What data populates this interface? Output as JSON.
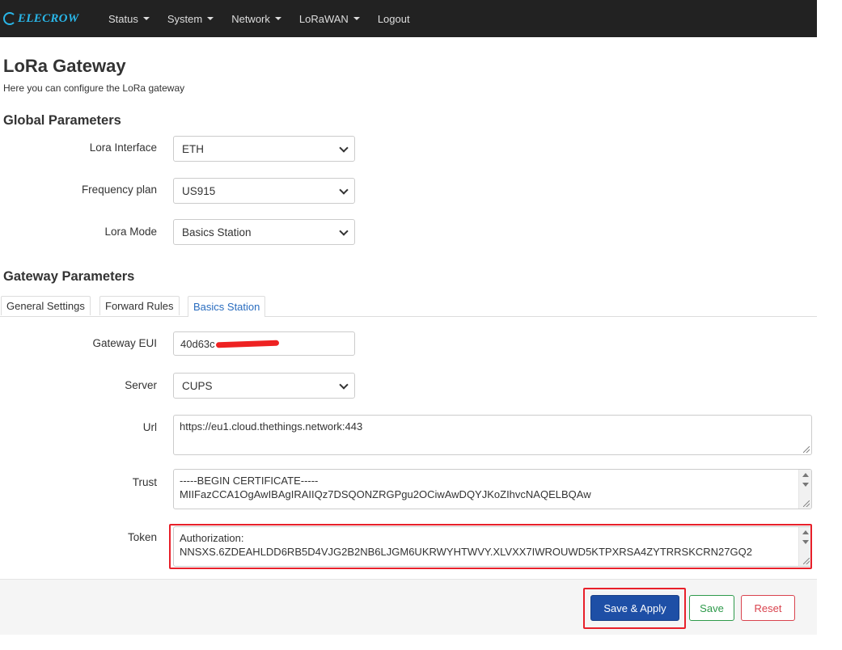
{
  "brand": {
    "name": "ELECROW",
    "color": "#29b6e8"
  },
  "nav": [
    {
      "label": "Status",
      "dropdown": true
    },
    {
      "label": "System",
      "dropdown": true
    },
    {
      "label": "Network",
      "dropdown": true
    },
    {
      "label": "LoRaWAN",
      "dropdown": true
    },
    {
      "label": "Logout",
      "dropdown": false
    }
  ],
  "page": {
    "title": "LoRa Gateway",
    "description": "Here you can configure the LoRa gateway"
  },
  "global": {
    "heading": "Global Parameters",
    "lora_interface": {
      "label": "Lora Interface",
      "value": "ETH"
    },
    "frequency_plan": {
      "label": "Frequency plan",
      "value": "US915"
    },
    "lora_mode": {
      "label": "Lora Mode",
      "value": "Basics Station"
    }
  },
  "gateway": {
    "heading": "Gateway Parameters",
    "tabs": [
      "General Settings",
      "Forward Rules",
      "Basics Station"
    ],
    "active_tab": "Basics Station",
    "eui": {
      "label": "Gateway EUI",
      "value": "40d63c"
    },
    "server": {
      "label": "Server",
      "value": "CUPS"
    },
    "url": {
      "label": "Url",
      "value": "https://eu1.cloud.thethings.network:443"
    },
    "trust": {
      "label": "Trust",
      "lines": [
        "-----BEGIN CERTIFICATE-----",
        "MIIFazCCA1OgAwIBAgIRAIIQz7DSQONZRGPgu2OCiwAwDQYJKoZIhvcNAQELBQAw"
      ]
    },
    "token": {
      "label": "Token",
      "lines": [
        "Authorization:",
        "NNSXS.6ZDEAHLDD6RB5D4VJG2B2NB6LJGM6UKRWYHTWVY.XLVXX7IWROUWD5KTPXRSA4ZYTRRSKCRN27GQ2"
      ]
    }
  },
  "actions": {
    "save_apply": "Save & Apply",
    "save": "Save",
    "reset": "Reset"
  },
  "colors": {
    "highlight": "#e8202a",
    "primary": "#1e4fa6",
    "save": "#2e9a4b",
    "reset": "#d9434e",
    "navbar": "#222222"
  }
}
